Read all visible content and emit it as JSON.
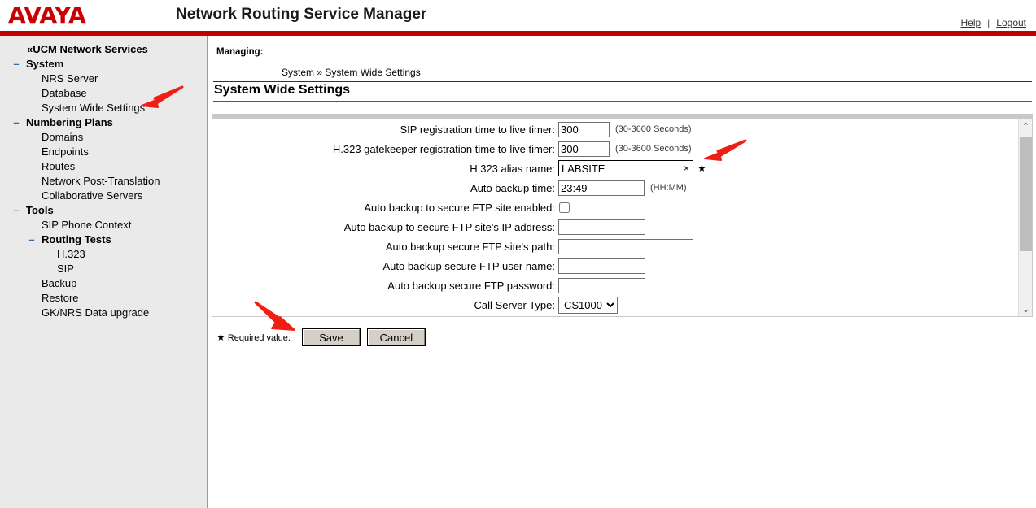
{
  "header": {
    "logo_text": "AVAYA",
    "app_title": "Network Routing Service Manager",
    "help_label": "Help",
    "separator": "|",
    "logout_label": "Logout",
    "accent_color": "#c00000"
  },
  "sidebar": {
    "items": [
      {
        "label": "«UCM Network Services",
        "level": 0,
        "bold": true,
        "twisty": ""
      },
      {
        "label": "System",
        "level": 0,
        "bold": true,
        "twisty": "–"
      },
      {
        "label": "NRS Server",
        "level": 1,
        "bold": false,
        "twisty": ""
      },
      {
        "label": "Database",
        "level": 1,
        "bold": false,
        "twisty": ""
      },
      {
        "label": "System Wide Settings",
        "level": 1,
        "bold": false,
        "twisty": ""
      },
      {
        "label": "Numbering Plans",
        "level": 0,
        "bold": true,
        "twisty": "–"
      },
      {
        "label": "Domains",
        "level": 1,
        "bold": false,
        "twisty": ""
      },
      {
        "label": "Endpoints",
        "level": 1,
        "bold": false,
        "twisty": ""
      },
      {
        "label": "Routes",
        "level": 1,
        "bold": false,
        "twisty": ""
      },
      {
        "label": "Network Post-Translation",
        "level": 1,
        "bold": false,
        "twisty": ""
      },
      {
        "label": "Collaborative Servers",
        "level": 1,
        "bold": false,
        "twisty": ""
      },
      {
        "label": "Tools",
        "level": 0,
        "bold": true,
        "twisty": "–"
      },
      {
        "label": "SIP Phone Context",
        "level": 1,
        "bold": false,
        "twisty": ""
      },
      {
        "label": "Routing Tests",
        "level": 1,
        "bold": true,
        "twisty": "–"
      },
      {
        "label": "H.323",
        "level": 2,
        "bold": false,
        "twisty": ""
      },
      {
        "label": "SIP",
        "level": 2,
        "bold": false,
        "twisty": ""
      },
      {
        "label": "Backup",
        "level": 1,
        "bold": false,
        "twisty": ""
      },
      {
        "label": "Restore",
        "level": 1,
        "bold": false,
        "twisty": ""
      },
      {
        "label": "GK/NRS Data upgrade",
        "level": 1,
        "bold": false,
        "twisty": ""
      }
    ]
  },
  "main": {
    "managing_label": "Managing:",
    "breadcrumb": "System » System Wide Settings",
    "page_title": "System Wide Settings"
  },
  "form": {
    "fields": [
      {
        "id": "sip-registration-ttl",
        "label": "SIP registration time to live timer:",
        "type": "text",
        "value": "300",
        "hint": "(30-3600 Seconds)",
        "required": false
      },
      {
        "id": "h323-gatekeeper-registration-ttl",
        "label": "H.323 gatekeeper registration time to live timer:",
        "type": "text",
        "value": "300",
        "hint": "(30-3600 Seconds)",
        "required": false
      },
      {
        "id": "h323-alias-name",
        "label": "H.323 alias name:",
        "type": "text-clearable",
        "value": "LABSITE",
        "hint": "",
        "clear_glyph": "×",
        "required": true,
        "required_glyph": "★"
      },
      {
        "id": "auto-backup-time",
        "label": "Auto backup time:",
        "type": "text",
        "value": "23:49",
        "hint": "(HH:MM)",
        "required": false
      },
      {
        "id": "auto-backup-ftp-enabled",
        "label": "Auto backup to secure FTP site enabled:",
        "type": "checkbox",
        "checked": false,
        "hint": "",
        "required": false
      },
      {
        "id": "auto-backup-ftp-ip",
        "label": "Auto backup to secure FTP site's IP address:",
        "type": "text",
        "value": "",
        "hint": "",
        "required": false
      },
      {
        "id": "auto-backup-ftp-path",
        "label": "Auto backup secure FTP site's path:",
        "type": "text",
        "value": "",
        "hint": "",
        "required": false
      },
      {
        "id": "auto-backup-ftp-username",
        "label": "Auto backup secure FTP user name:",
        "type": "text",
        "value": "",
        "hint": "",
        "required": false
      },
      {
        "id": "auto-backup-ftp-password",
        "label": "Auto backup secure FTP password:",
        "type": "text",
        "value": "",
        "hint": "",
        "required": false
      },
      {
        "id": "call-server-type",
        "label": "Call Server Type:",
        "type": "select",
        "value": "CS1000",
        "options": [
          "CS1000"
        ],
        "hint": "",
        "required": false
      }
    ]
  },
  "scrollbar": {
    "up_glyph": "⌃",
    "down_glyph": "⌄"
  },
  "actions": {
    "required_star": "★",
    "required_note": "Required value.",
    "save_label": "Save",
    "cancel_label": "Cancel"
  },
  "annotations": {
    "arrow_color": "#f01e14",
    "arrows": [
      {
        "name": "arrow-to-system-wide-settings",
        "points_to": "System Wide Settings"
      },
      {
        "name": "arrow-to-h323-alias-name",
        "points_to": "H.323 alias name"
      },
      {
        "name": "arrow-to-save-button",
        "points_to": "Save"
      }
    ]
  }
}
